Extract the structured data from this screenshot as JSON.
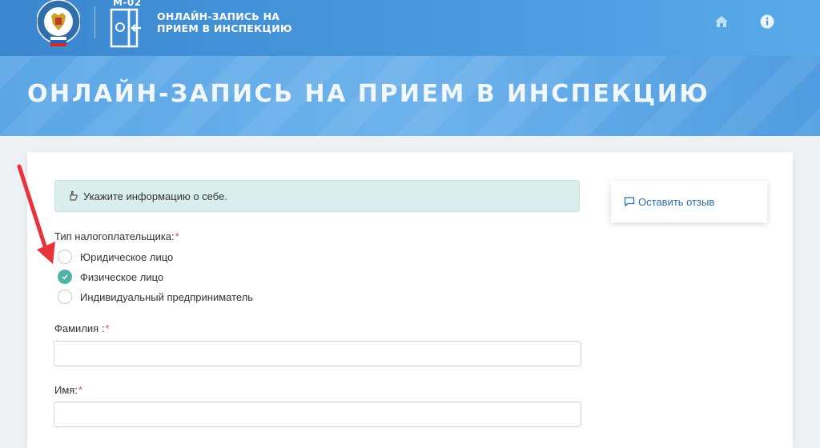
{
  "header": {
    "emblem_text": "Федеральная налоговая служба",
    "service_code": "М-02",
    "brand_line1": "ОНЛАЙН-ЗАПИСЬ НА",
    "brand_line2": "ПРИЕМ В ИНСПЕКЦИЮ",
    "icons": [
      "home-icon",
      "info-icon"
    ]
  },
  "hero": {
    "title": "ОНЛАЙН-ЗАПИСЬ НА ПРИЕМ В ИНСПЕКЦИЮ"
  },
  "alert": {
    "text": "Укажите информацию о себе.",
    "icon": "hand-point-icon"
  },
  "feedback": {
    "label": "Оставить отзыв",
    "icon": "comment-icon"
  },
  "form": {
    "taxpayer_type_label": "Тип налогоплательщика:",
    "required_mark": "*",
    "taxpayer_options": [
      {
        "label": "Юридическое лицо",
        "selected": false
      },
      {
        "label": "Физическое лицо",
        "selected": true
      },
      {
        "label": "Индивидуальный предприниматель",
        "selected": false
      }
    ],
    "surname_label": "Фамилия :",
    "surname_value": "",
    "name_label": "Имя:",
    "name_value": ""
  },
  "colors": {
    "header": "#4a9be0",
    "hero": "#6db2ec",
    "radio_checked": "#4fb3a9",
    "alert_bg": "#dbeeee",
    "annotation_arrow": "#e8323c"
  }
}
